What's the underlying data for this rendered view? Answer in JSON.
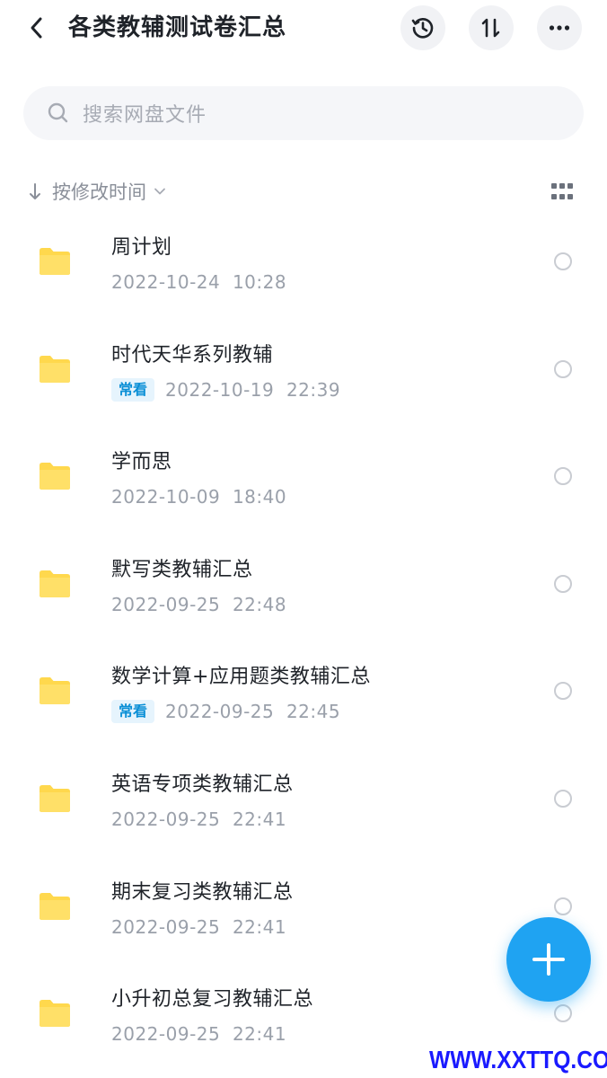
{
  "header": {
    "title": "各类教辅测试卷汇总",
    "back_icon": "chevron-left-icon",
    "history_icon": "history-icon",
    "sort_icon": "sort-icon",
    "more_icon": "more-icon"
  },
  "search": {
    "placeholder": "搜索网盘文件",
    "icon": "search-icon"
  },
  "sort": {
    "label": "按修改时间",
    "view_icon": "grid-view-icon"
  },
  "colors": {
    "folder": "#ffd84d",
    "accent": "#1fa3f2",
    "tag_text": "#0a8fd6",
    "tag_bg": "#e6f4fd",
    "watermark": "#1a1aff"
  },
  "files": [
    {
      "name": "周计划",
      "tag": "",
      "date": "2022-10-24  10:28"
    },
    {
      "name": "时代天华系列教辅",
      "tag": "常看",
      "date": "2022-10-19  22:39"
    },
    {
      "name": "学而思",
      "tag": "",
      "date": "2022-10-09  18:40"
    },
    {
      "name": "默写类教辅汇总",
      "tag": "",
      "date": "2022-09-25  22:48"
    },
    {
      "name": "数学计算+应用题类教辅汇总",
      "tag": "常看",
      "date": "2022-09-25  22:45"
    },
    {
      "name": "英语专项类教辅汇总",
      "tag": "",
      "date": "2022-09-25  22:41"
    },
    {
      "name": "期末复习类教辅汇总",
      "tag": "",
      "date": "2022-09-25  22:41"
    },
    {
      "name": "小升初总复习教辅汇总",
      "tag": "",
      "date": "2022-09-25  22:41"
    }
  ],
  "fab": {
    "icon": "plus-icon"
  },
  "watermark": "WWW.XXTTQ.COM"
}
